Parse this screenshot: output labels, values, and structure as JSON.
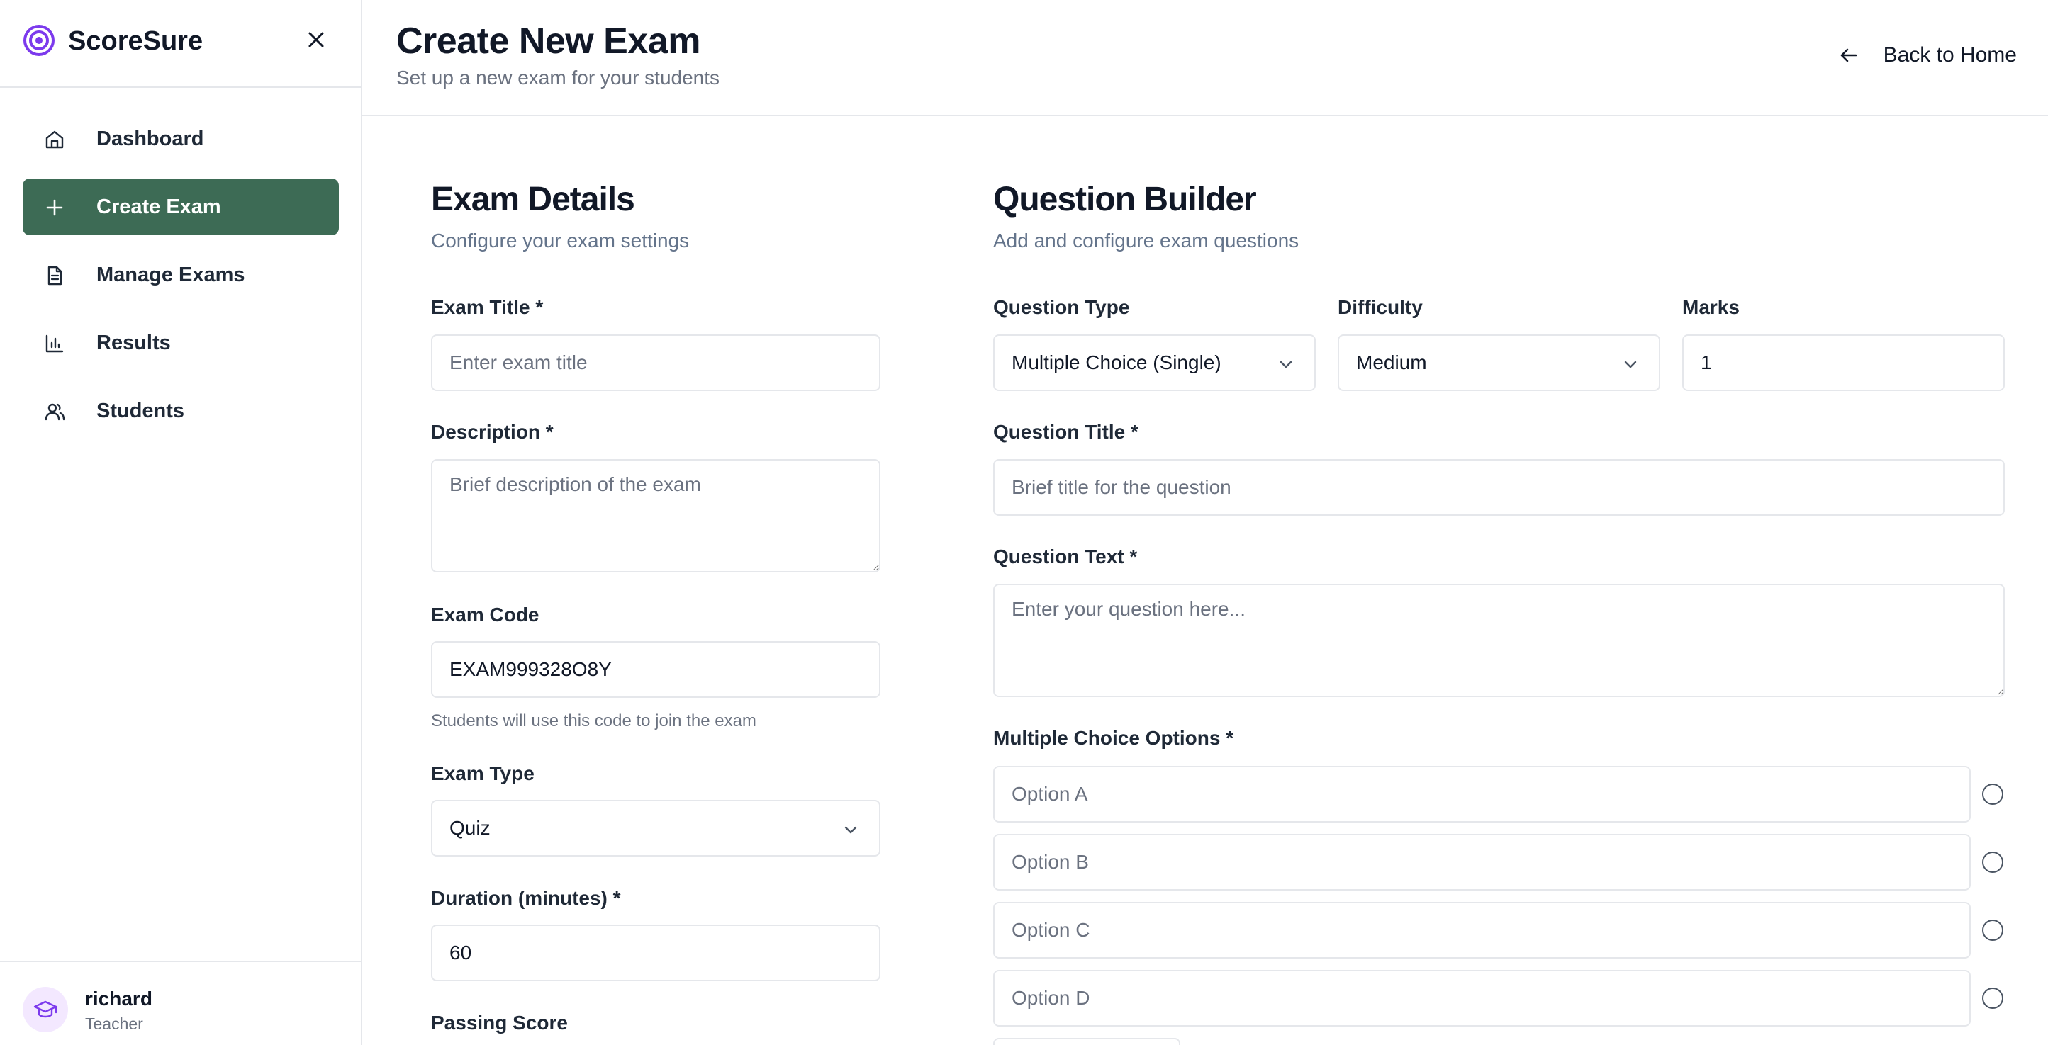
{
  "app": {
    "name": "ScoreSure"
  },
  "sidebar": {
    "items": [
      {
        "label": "Dashboard",
        "icon": "home-icon"
      },
      {
        "label": "Create Exam",
        "icon": "plus-icon",
        "active": true
      },
      {
        "label": "Manage Exams",
        "icon": "file-text-icon"
      },
      {
        "label": "Results",
        "icon": "bar-chart-icon"
      },
      {
        "label": "Students",
        "icon": "users-icon"
      }
    ],
    "user": {
      "name": "richard",
      "role": "Teacher",
      "avatar_icon": "graduation-cap-icon"
    }
  },
  "header": {
    "title": "Create New Exam",
    "subtitle": "Set up a new exam for your students",
    "back_label": "Back to Home"
  },
  "exam_details": {
    "title": "Exam Details",
    "subtitle": "Configure your exam settings",
    "exam_title_label": "Exam Title *",
    "exam_title_placeholder": "Enter exam title",
    "description_label": "Description *",
    "description_placeholder": "Brief description of the exam",
    "exam_code_label": "Exam Code",
    "exam_code_value": "EXAM999328O8Y",
    "exam_code_hint": "Students will use this code to join the exam",
    "exam_type_label": "Exam Type",
    "exam_type_value": "Quiz",
    "duration_label": "Duration (minutes) *",
    "duration_value": "60",
    "passing_score_label": "Passing Score"
  },
  "question_builder": {
    "title": "Question Builder",
    "subtitle": "Add and configure exam questions",
    "question_type_label": "Question Type",
    "question_type_value": "Multiple Choice (Single)",
    "difficulty_label": "Difficulty",
    "difficulty_value": "Medium",
    "marks_label": "Marks",
    "marks_value": "1",
    "question_title_label": "Question Title *",
    "question_title_placeholder": "Brief title for the question",
    "question_text_label": "Question Text *",
    "question_text_placeholder": "Enter your question here...",
    "options_label": "Multiple Choice Options *",
    "options": [
      {
        "placeholder": "Option A"
      },
      {
        "placeholder": "Option B"
      },
      {
        "placeholder": "Option C"
      },
      {
        "placeholder": "Option D"
      }
    ]
  },
  "colors": {
    "accent": "#3d6b55",
    "brand": "#7c3aed",
    "border": "#e5e7eb",
    "muted_text": "#6b7280"
  }
}
